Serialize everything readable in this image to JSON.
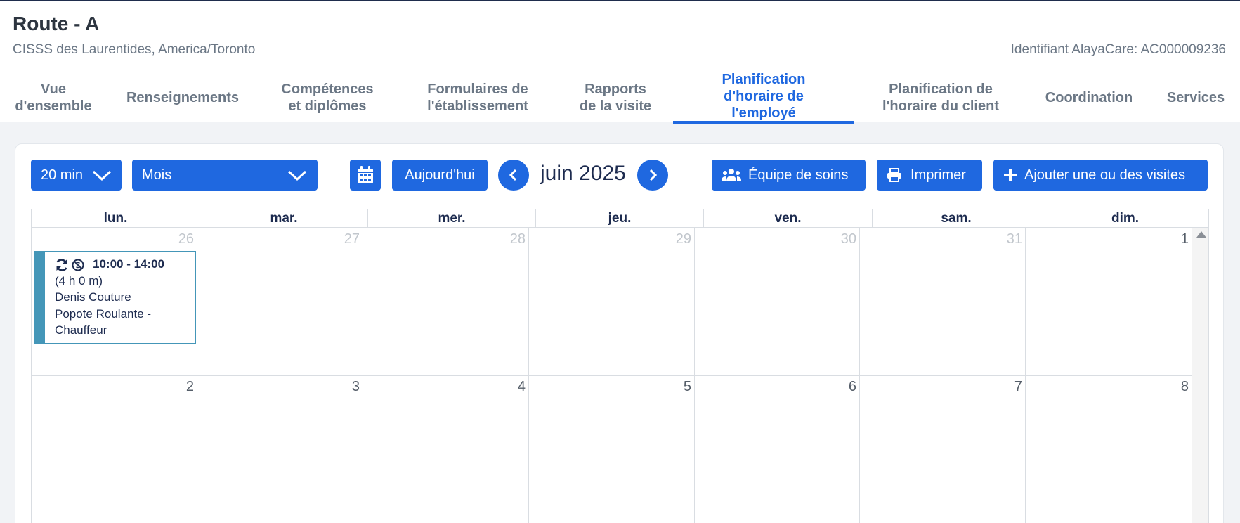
{
  "header": {
    "title": "Route - A",
    "subtitle": "CISSS des Laurentides, America/Toronto",
    "identifier": "Identifiant AlayaCare: AC000009236"
  },
  "tabs": [
    {
      "label": "Vue\nd'ensemble"
    },
    {
      "label": "Renseignements"
    },
    {
      "label": "Compétences\net diplômes"
    },
    {
      "label": "Formulaires de\nl'établissement"
    },
    {
      "label": "Rapports\nde la visite"
    },
    {
      "label": "Planification\nd'horaire de\nl'employé",
      "active": true
    },
    {
      "label": "Planification de\nl'horaire du client"
    },
    {
      "label": "Coordination"
    },
    {
      "label": "Services"
    }
  ],
  "toolbar": {
    "interval": "20 min",
    "view": "Mois",
    "today": "Aujourd'hui",
    "month": "juin 2025",
    "care_team": "Équipe de soins",
    "print": "Imprimer",
    "add_visits": "Ajouter une ou des visites"
  },
  "calendar": {
    "weekdays": [
      "lun.",
      "mar.",
      "mer.",
      "jeu.",
      "ven.",
      "sam.",
      "dim."
    ],
    "weeks": [
      [
        {
          "day": "26",
          "other": true
        },
        {
          "day": "27",
          "other": true
        },
        {
          "day": "28",
          "other": true
        },
        {
          "day": "29",
          "other": true
        },
        {
          "day": "30",
          "other": true
        },
        {
          "day": "31",
          "other": true
        },
        {
          "day": "1",
          "other": false
        }
      ],
      [
        {
          "day": "2",
          "other": false
        },
        {
          "day": "3",
          "other": false
        },
        {
          "day": "4",
          "other": false
        },
        {
          "day": "5",
          "other": false
        },
        {
          "day": "6",
          "other": false
        },
        {
          "day": "7",
          "other": false
        },
        {
          "day": "8",
          "other": false
        }
      ]
    ],
    "event": {
      "time": "10:00 - 14:00",
      "duration": "(4 h 0 m)",
      "client": "Denis Couture",
      "service_line1": "Popote Roulante -",
      "service_line2": "Chauffeur",
      "color": "#4496b8"
    }
  },
  "colors": {
    "accent": "#1f68e0",
    "title": "#1d2b4f"
  }
}
